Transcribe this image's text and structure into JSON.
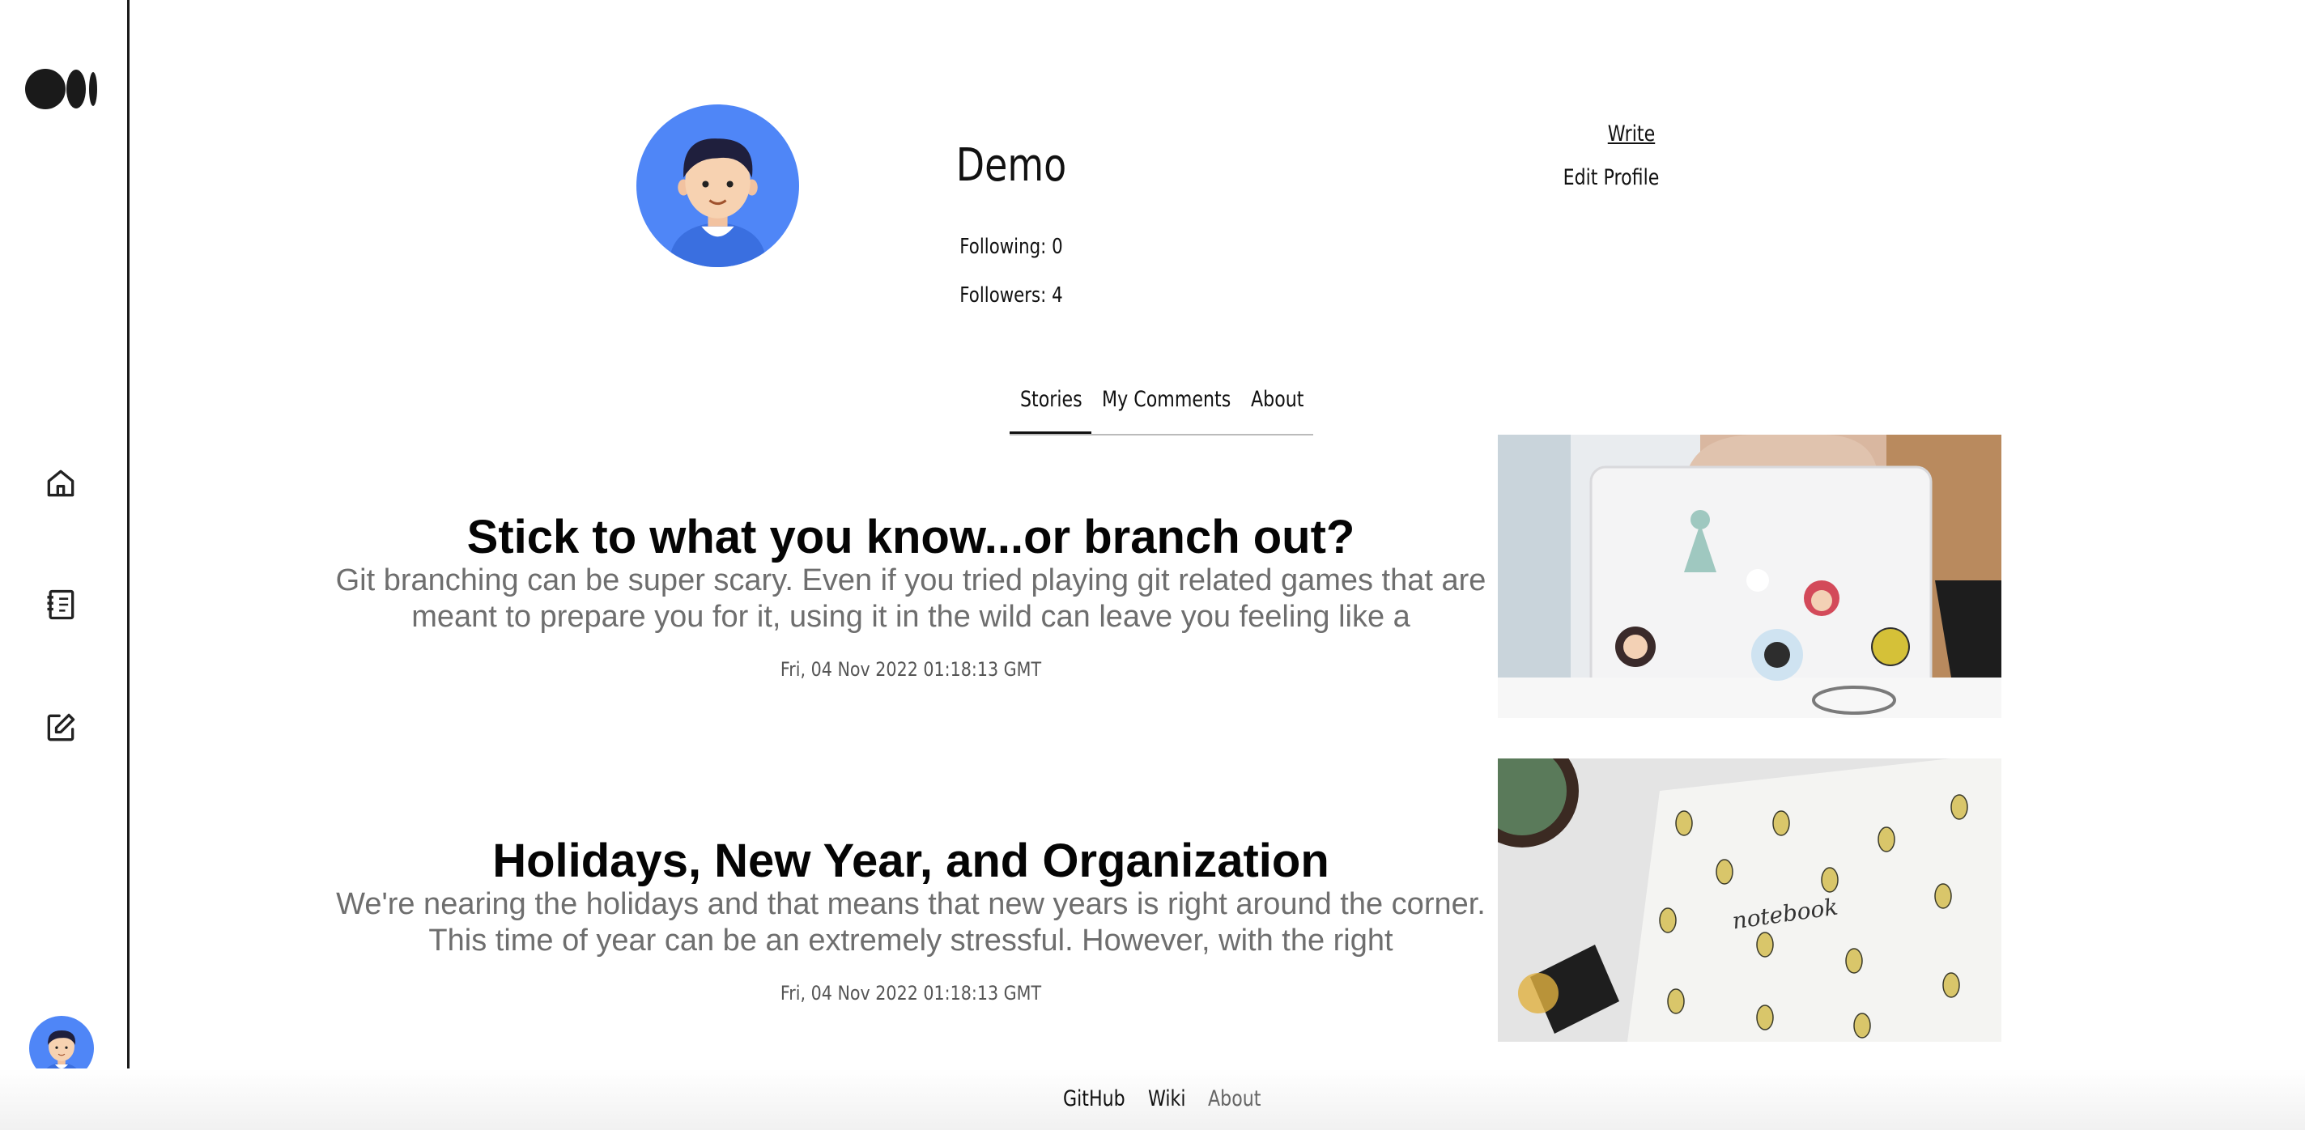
{
  "profile": {
    "name": "Demo",
    "following": "Following: 0",
    "followers": "Followers: 4"
  },
  "actions": {
    "write": "Write",
    "edit_profile": "Edit Profile"
  },
  "tabs": [
    {
      "label": "Stories",
      "active": true
    },
    {
      "label": "My Comments",
      "active": false
    },
    {
      "label": "About",
      "active": false
    }
  ],
  "stories": [
    {
      "title": "Stick to what you know...or branch out?",
      "excerpt": "Git branching can be super scary. Even if you tried playing git related games that are meant to prepare you for it, using it in the wild can leave you feeling like a",
      "date": "Fri, 04 Nov 2022 01:18:13 GMT",
      "image": "laptop-with-octocat-stickers"
    },
    {
      "title": "Holidays, New Year, and Organization",
      "excerpt": "We're nearing the holidays and that means that new years is right around the corner. This time of year can be an extremely stressful. However, with the right",
      "date": "Fri, 04 Nov 2022 01:18:13 GMT",
      "image": "pineapple-notebook",
      "image_text": "notebook"
    }
  ],
  "footer": {
    "github": "GitHub",
    "wiki": "Wiki",
    "about": "About"
  },
  "sidebar": {
    "icons": [
      "medium-logo-icon",
      "home-icon",
      "stories-book-icon",
      "write-edit-icon",
      "user-avatar"
    ]
  },
  "colors": {
    "avatar_bg": "#4f86f7",
    "text_muted": "#6e6e6e",
    "border": "#1a1a1a"
  }
}
